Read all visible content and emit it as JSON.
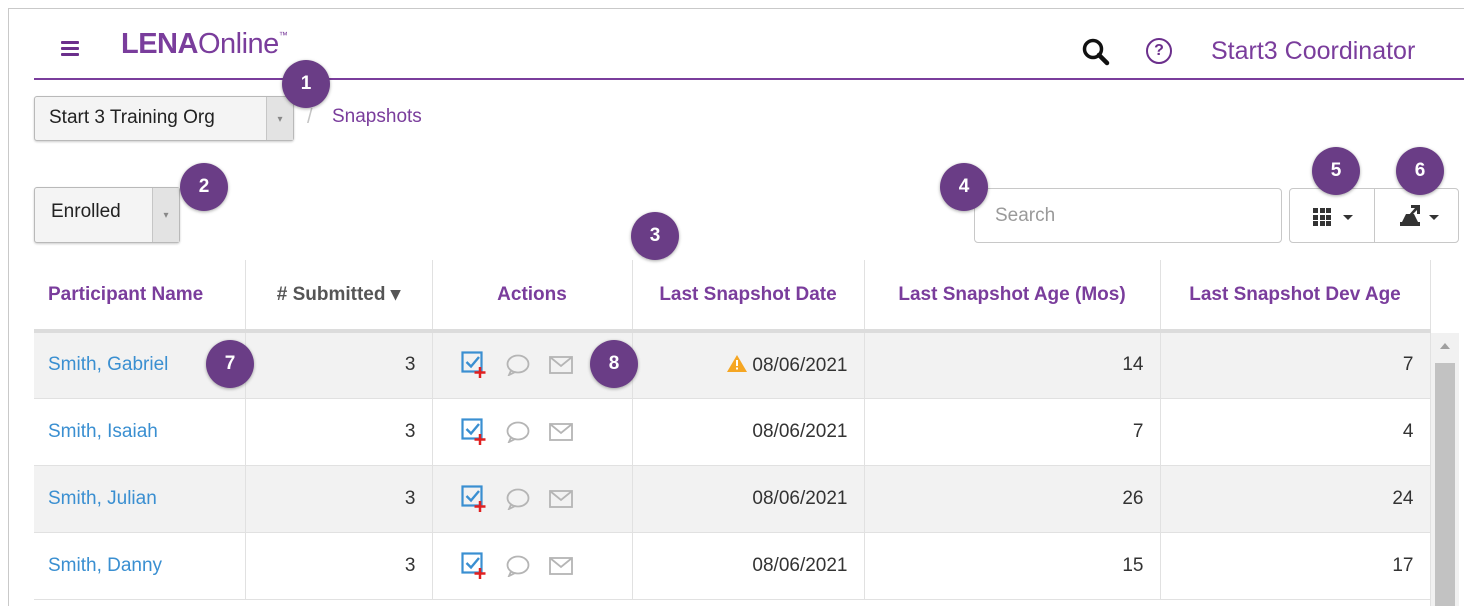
{
  "app": {
    "logo_bold": "LENA",
    "logo_light": "Online",
    "logo_tm": "™",
    "user_name": "Start3 Coordinator",
    "help_glyph": "?"
  },
  "icons": {
    "menu": "hamburger-icon",
    "search": "search-icon",
    "help": "help-circle-icon",
    "columns": "grid-icon",
    "export": "export-icon",
    "record": "checkbox-add-icon",
    "comment": "comment-icon",
    "email": "envelope-icon",
    "warning": "warning-icon"
  },
  "colors": {
    "brand": "#7a3d9c",
    "badge": "#6a3d86",
    "link": "#3a8fd1",
    "warning": "#f5a623"
  },
  "org_selector": {
    "value": "Start 3 Training Org",
    "arrow": "▾"
  },
  "breadcrumb": {
    "separator": "/",
    "current": "Snapshots"
  },
  "status_filter": {
    "value": "Enrolled",
    "arrow": "▾"
  },
  "search": {
    "placeholder": "Search",
    "value": ""
  },
  "badges": [
    "1",
    "2",
    "3",
    "4",
    "5",
    "6",
    "7",
    "8"
  ],
  "table": {
    "columns": [
      "Participant Name",
      "# Submitted",
      "Actions",
      "Last Snapshot Date",
      "Last Snapshot Age (Mos)",
      "Last Snapshot Dev Age"
    ],
    "sort_indicator": "▾",
    "rows": [
      {
        "name": "Smith, Gabriel",
        "submitted": "3",
        "date": "08/06/2021",
        "age": "14",
        "dev_age": "7",
        "warning": true
      },
      {
        "name": "Smith, Isaiah",
        "submitted": "3",
        "date": "08/06/2021",
        "age": "7",
        "dev_age": "4",
        "warning": false
      },
      {
        "name": "Smith, Julian",
        "submitted": "3",
        "date": "08/06/2021",
        "age": "26",
        "dev_age": "24",
        "warning": false
      },
      {
        "name": "Smith, Danny",
        "submitted": "3",
        "date": "08/06/2021",
        "age": "15",
        "dev_age": "17",
        "warning": false
      }
    ]
  }
}
